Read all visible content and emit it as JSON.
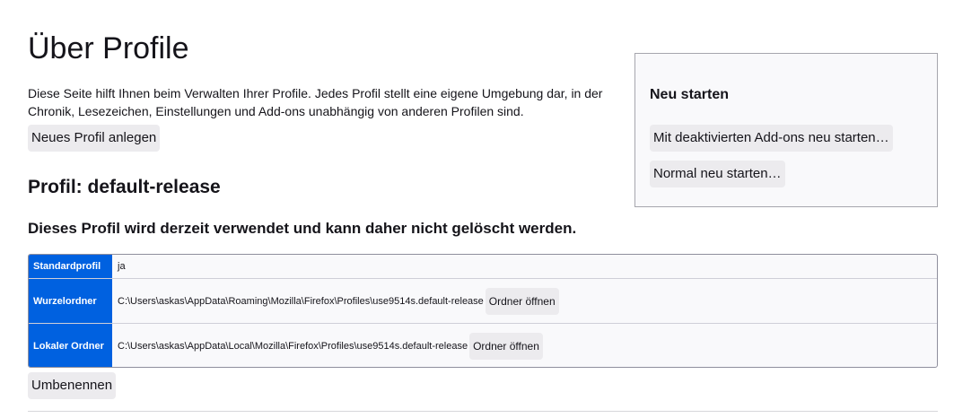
{
  "page": {
    "title": "Über Profile",
    "intro": "Diese Seite hilft Ihnen beim Verwalten Ihrer Profile. Jedes Profil stellt eine eigene Umgebung dar, in der Chronik, Lesezeichen, Einstellungen und Add-ons unabhängig von anderen Profilen sind.",
    "new_profile_label": "Neues Profil anlegen"
  },
  "restart": {
    "title": "Neu starten",
    "safe_mode_label": "Mit deaktivierten Add-ons neu starten…",
    "normal_label": "Normal neu starten…"
  },
  "profile": {
    "heading": "Profil: default-release",
    "in_use_notice": "Dieses Profil wird derzeit verwendet und kann daher nicht gelöscht werden.",
    "rows": [
      {
        "key": "Standardprofil",
        "value": "ja"
      },
      {
        "key": "Wurzelordner",
        "value": "C:\\Users\\askas\\AppData\\Roaming\\Mozilla\\Firefox\\Profiles\\use9514s.default-release",
        "button": "Ordner öffnen"
      },
      {
        "key": "Lokaler Ordner",
        "value": "C:\\Users\\askas\\AppData\\Local\\Mozilla\\Firefox\\Profiles\\use9514s.default-release",
        "button": "Ordner öffnen"
      }
    ],
    "rename_label": "Umbenennen"
  },
  "colors": {
    "accent": "#0061e0",
    "button_bg": "#ecebee",
    "panel_bg": "#f9f9fb",
    "text": "#15141a"
  }
}
